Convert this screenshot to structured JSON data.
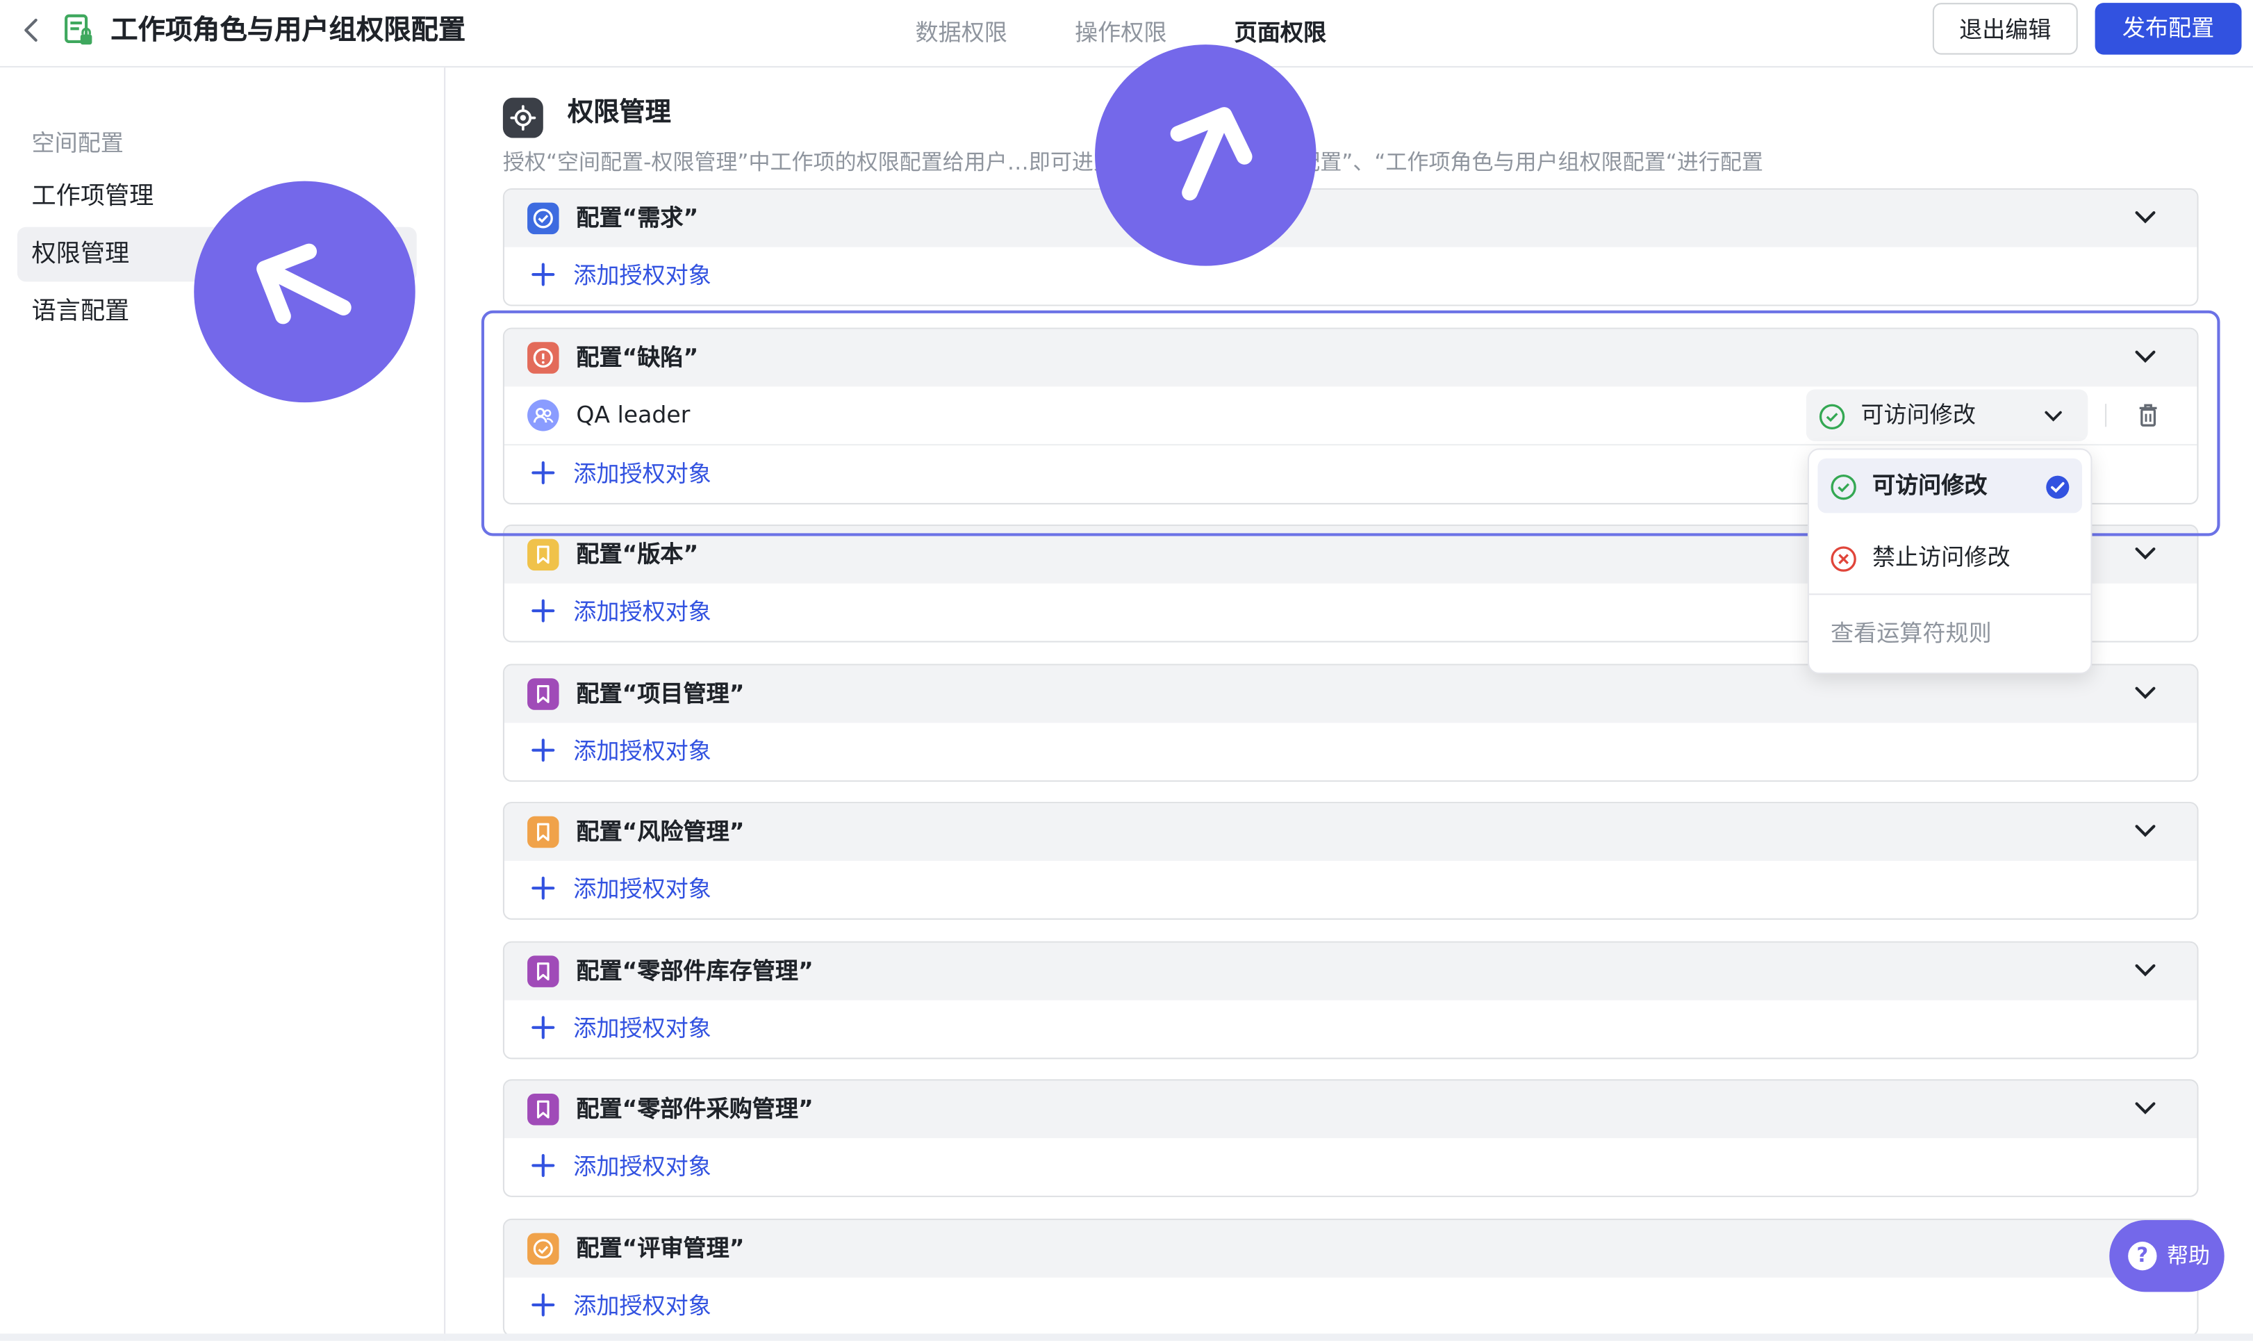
{
  "header": {
    "back_icon": "chevron-left-icon",
    "app_icon": "doc-lock-icon",
    "title": "工作项角色与用户组权限配置",
    "tabs": [
      {
        "label": "数据权限",
        "active": false
      },
      {
        "label": "操作权限",
        "active": false
      },
      {
        "label": "页面权限",
        "active": true
      }
    ],
    "exit_label": "退出编辑",
    "publish_label": "发布配置"
  },
  "sidebar": {
    "group": "空间配置",
    "items": [
      {
        "label": "工作项管理",
        "active": false
      },
      {
        "label": "权限管理",
        "active": true
      },
      {
        "label": "语言配置",
        "active": false
      }
    ]
  },
  "section": {
    "icon": "gear-icon",
    "title": "权限管理",
    "description": "授权“空间配置-权限管理”中工作项的权限配置给用户…即可进入“空间成员基础权限配置”、“工作项角色与用户组权限配置“进行配置"
  },
  "add_label": "添加授权对象",
  "cards": [
    {
      "title": "配置“需求”",
      "badge_color": "#3d6be0",
      "badge_icon": "check-circle-icon"
    },
    {
      "title": "配置“缺陷”",
      "badge_color": "#e36b5a",
      "badge_icon": "alert-circle-icon"
    },
    {
      "title": "配置“版本”",
      "badge_color": "#f0c24a",
      "badge_icon": "bookmark-icon"
    },
    {
      "title": "配置“项目管理”",
      "badge_color": "#a04bb8",
      "badge_icon": "bookmark-icon"
    },
    {
      "title": "配置“风险管理”",
      "badge_color": "#f0a24a",
      "badge_icon": "bookmark-icon"
    },
    {
      "title": "配置“零部件库存管理”",
      "badge_color": "#a04bb8",
      "badge_icon": "bookmark-icon"
    },
    {
      "title": "配置“零部件采购管理”",
      "badge_color": "#a04bb8",
      "badge_icon": "bookmark-icon"
    },
    {
      "title": "配置“评审管理”",
      "badge_color": "#f0a24a",
      "badge_icon": "smile-icon"
    }
  ],
  "bug_card_entry": {
    "name": "QA leader",
    "permission": "可访问修改",
    "avatar_icon": "user-group-icon"
  },
  "dropdown": {
    "options": [
      {
        "label": "可访问修改",
        "selected": true,
        "icon": "check-circle-icon"
      },
      {
        "label": "禁止访问修改",
        "selected": false,
        "icon": "x-circle-icon"
      }
    ],
    "link": "查看运算符规则"
  },
  "help_label": "帮助",
  "colors": {
    "accent": "#3252e0",
    "annotation": "#7468ea",
    "success": "#34a853",
    "danger": "#e0453a"
  }
}
